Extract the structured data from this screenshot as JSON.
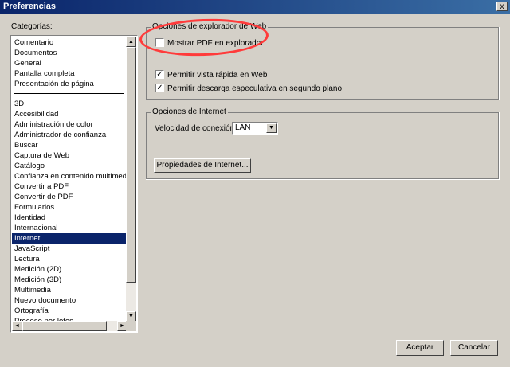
{
  "window": {
    "title": "Preferencias",
    "close_glyph": "x"
  },
  "categories": {
    "label": "Categorías:",
    "top_items": [
      "Comentario",
      "Documentos",
      "General",
      "Pantalla completa",
      "Presentación de página"
    ],
    "items": [
      "3D",
      "Accesibilidad",
      "Administración de color",
      "Administrador de confianza",
      "Buscar",
      "Captura de Web",
      "Catálogo",
      "Confianza en contenido multimedia",
      "Convertir a PDF",
      "Convertir de PDF",
      "Formularios",
      "Identidad",
      "Internacional",
      "Internet",
      "JavaScript",
      "Lectura",
      "Medición (2D)",
      "Medición (3D)",
      "Multimedia",
      "Nuevo documento",
      "Ortografía",
      "Proceso por lotes"
    ],
    "selected": "Internet"
  },
  "web_browser_options": {
    "title": "Opciones de explorador de Web",
    "show_pdf_in_browser": {
      "label": "Mostrar PDF en explorador",
      "checked": false
    },
    "fast_web_view": {
      "label": "Permitir vista rápida en Web",
      "checked": true
    },
    "speculative_download": {
      "label": "Permitir descarga especulativa en segundo plano",
      "checked": true
    }
  },
  "internet_options": {
    "title": "Opciones de Internet",
    "connection_speed_label": "Velocidad de conexión:",
    "connection_speed_value": "LAN",
    "properties_button": "Propiedades de Internet..."
  },
  "footer": {
    "accept": "Aceptar",
    "cancel": "Cancelar"
  },
  "annotation": {
    "color": "#ff3b3b"
  },
  "colors": {
    "selection": "#0a246a",
    "titlebar": "#0a246a",
    "dialog_bg": "#d4d0c8"
  }
}
